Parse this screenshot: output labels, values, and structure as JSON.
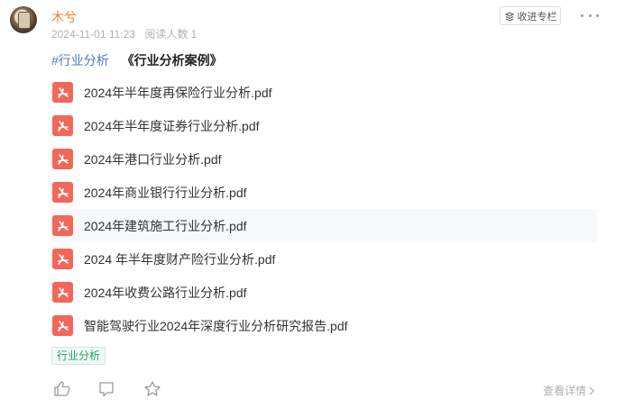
{
  "author": {
    "name": "木兮",
    "date": "2024-11-01 11:23",
    "readers": "阅读人数 1"
  },
  "header": {
    "collect_label": "收进专栏"
  },
  "post": {
    "hashtag": "#行业分析",
    "book_title": "《行业分析案例》"
  },
  "files": [
    "2024年半年度再保险行业分析.pdf",
    "2024年半年度证券行业分析.pdf",
    "2024年港口行业分析.pdf",
    "2024年商业银行行业分析.pdf",
    "2024年建筑施工行业分析.pdf",
    "2024 年半年度财产险行业分析.pdf",
    "2024年收费公路行业分析.pdf",
    "智能驾驶行业2024年深度行业分析研究报告.pdf"
  ],
  "tags": [
    "行业分析"
  ],
  "footer": {
    "detail_label": "查看详情"
  },
  "icons": [
    "like-icon",
    "comment-icon",
    "star-icon",
    "more-icon",
    "pdf-icon",
    "chevron-right-icon",
    "collect-icon"
  ],
  "colors": {
    "username": "#f0802e",
    "hashtag": "#4c7fc4",
    "pdf": "#f1675a",
    "tag": "#23a06a"
  }
}
